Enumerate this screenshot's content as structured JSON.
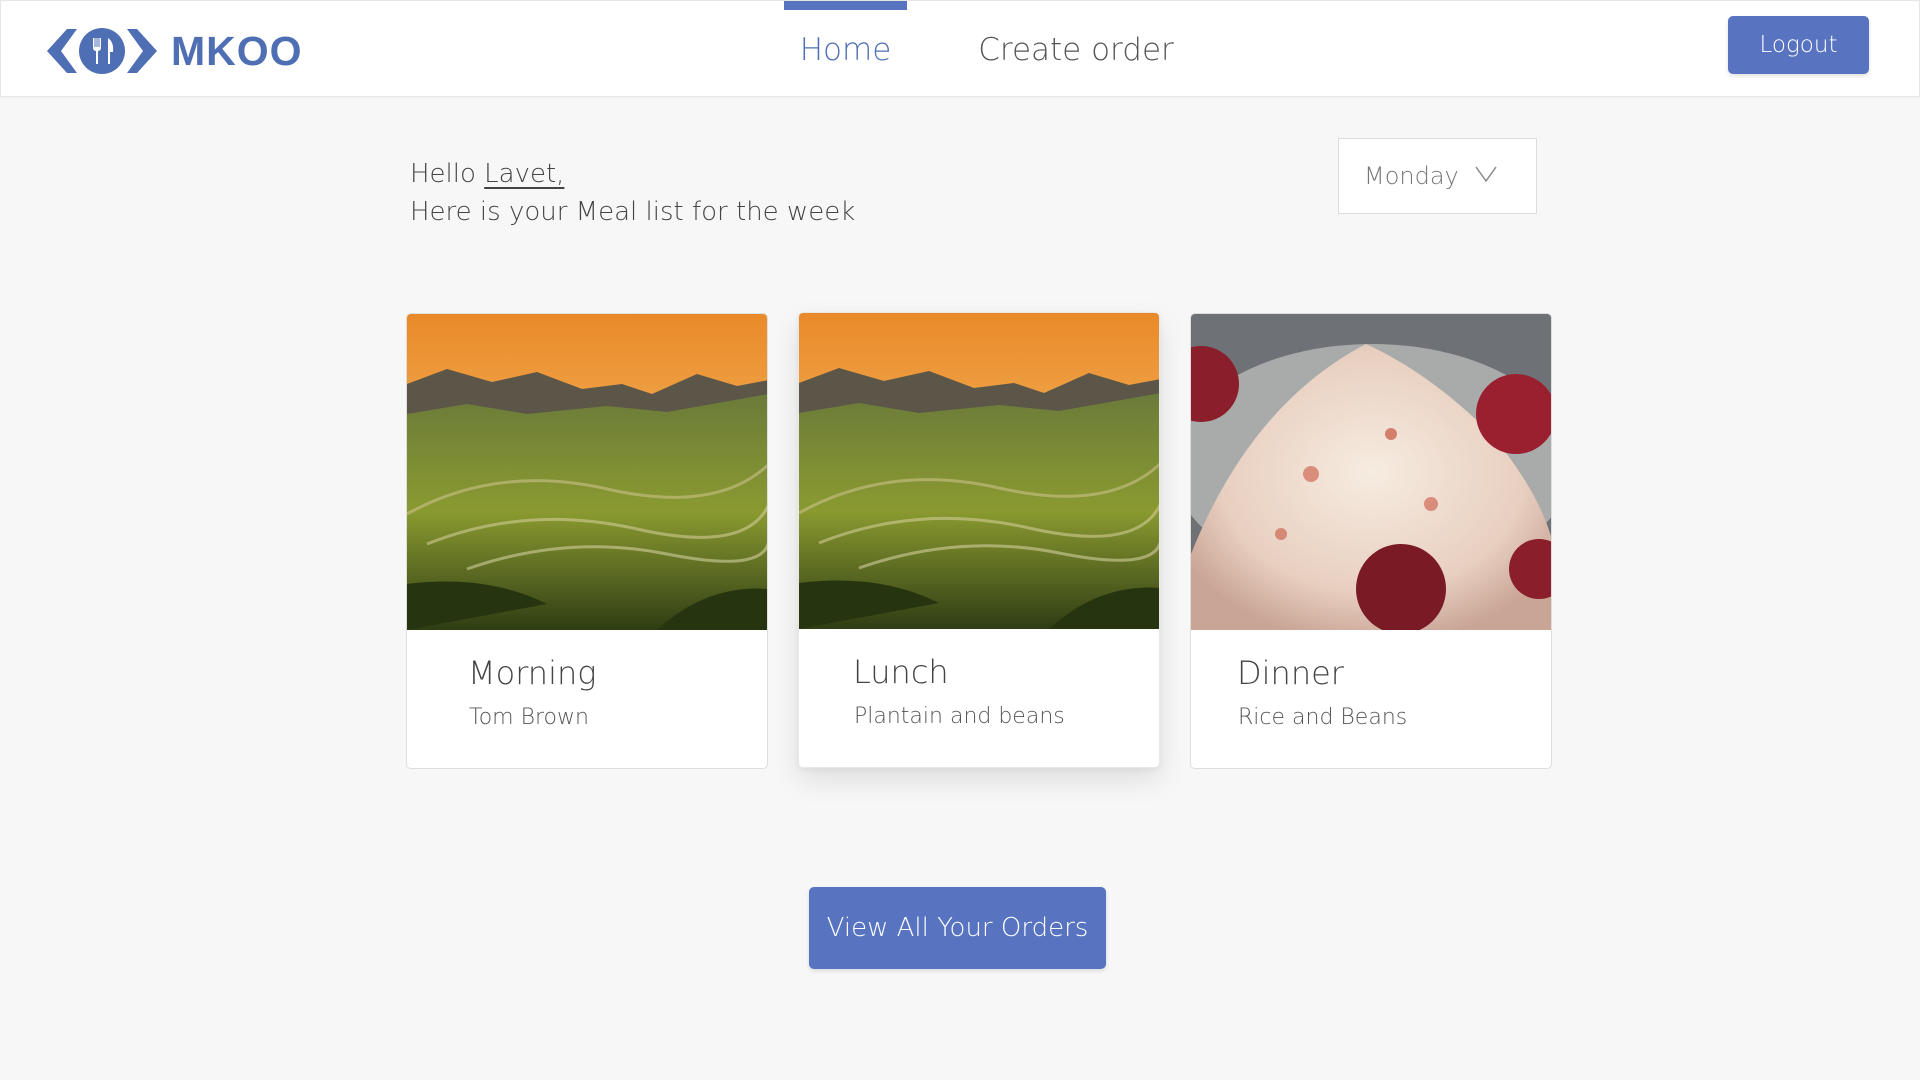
{
  "brand": {
    "name": "MKOO",
    "accent": "#5874c1",
    "logo_icon": "fork-knife-icon"
  },
  "nav": {
    "tabs": [
      {
        "label": "Home",
        "active": true
      },
      {
        "label": "Create order",
        "active": false
      }
    ],
    "logout_label": "Logout"
  },
  "greeting": {
    "hello": "Hello",
    "name": "Lavet,",
    "subtitle": "Here is your Meal list for the week"
  },
  "day_select": {
    "value": "Monday",
    "icon": "chevron-down-icon"
  },
  "meals": [
    {
      "title": "Morning",
      "item": "Tom Brown",
      "image": "terraced-hills-photo"
    },
    {
      "title": "Lunch",
      "item": "Plantain and beans",
      "image": "terraced-hills-photo"
    },
    {
      "title": "Dinner",
      "item": "Rice and Beans",
      "image": "rice-dish-photo"
    }
  ],
  "cta": {
    "label": "View All Your Orders"
  }
}
